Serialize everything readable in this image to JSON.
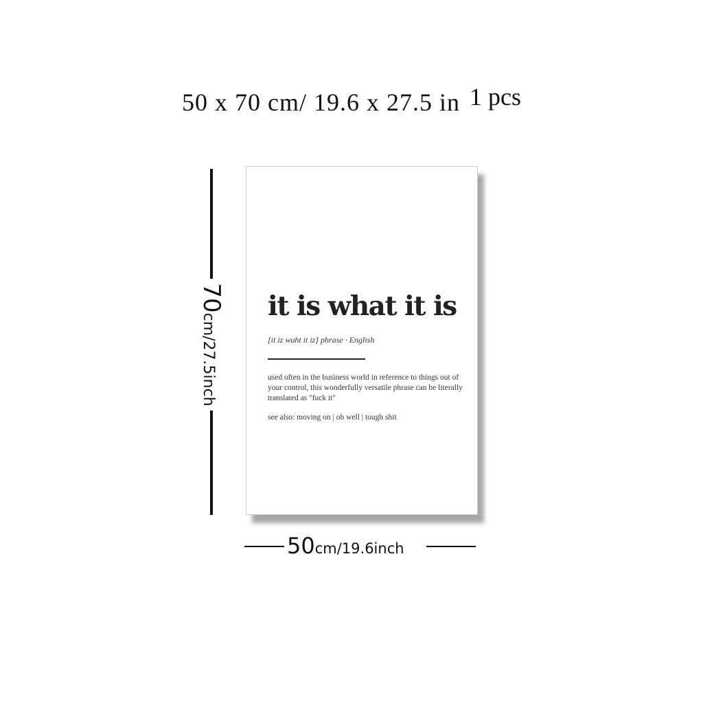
{
  "header": {
    "size_text": "50 x 70 cm/ 19.6 x 27.5 in",
    "count_text": "1 pcs"
  },
  "dimension_height": {
    "number": "70",
    "unit": "cm/27.5inch"
  },
  "dimension_width": {
    "number": "50",
    "unit": "cm/19.6inch"
  },
  "poster": {
    "title": "it is what it is",
    "phonetic": "[it iz wuht it iz] phrase · English",
    "definition": "used often in the business world in reference to things out of your control, this wonderfully versatile phrase can be literally translated as \"fuck it\"",
    "see_also": "see also: moving on | oh well | tough shit"
  }
}
